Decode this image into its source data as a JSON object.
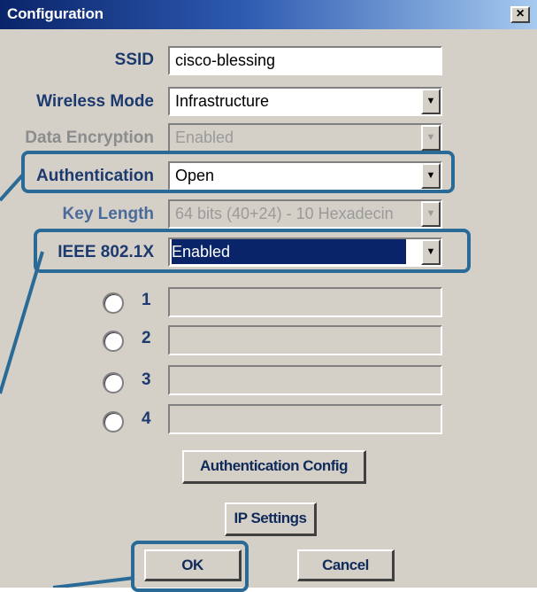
{
  "window": {
    "title": "Configuration",
    "close_glyph": "×",
    "close_icon": "close-icon"
  },
  "form": {
    "ssid": {
      "label": "SSID",
      "value": "cisco-blessing"
    },
    "wireless_mode": {
      "label": "Wireless Mode",
      "value": "Infrastructure"
    },
    "data_encryption": {
      "label": "Data Encryption",
      "value": "Enabled",
      "disabled": true
    },
    "authentication": {
      "label": "Authentication",
      "value": "Open"
    },
    "key_length": {
      "label": "Key Length",
      "value": "64 bits (40+24) - 10 Hexadecin",
      "disabled": true
    },
    "ieee8021x": {
      "label": "IEEE 802.1X",
      "value": "Enabled",
      "selected": true
    },
    "keys": [
      {
        "index": "1",
        "value": ""
      },
      {
        "index": "2",
        "value": ""
      },
      {
        "index": "3",
        "value": ""
      },
      {
        "index": "4",
        "value": ""
      }
    ]
  },
  "buttons": {
    "auth_config": "Authentication Config",
    "ip_settings": "IP Settings",
    "ok": "OK",
    "cancel": "Cancel"
  },
  "dropdown_glyph": "▼",
  "highlight_color": "#2a6a96"
}
